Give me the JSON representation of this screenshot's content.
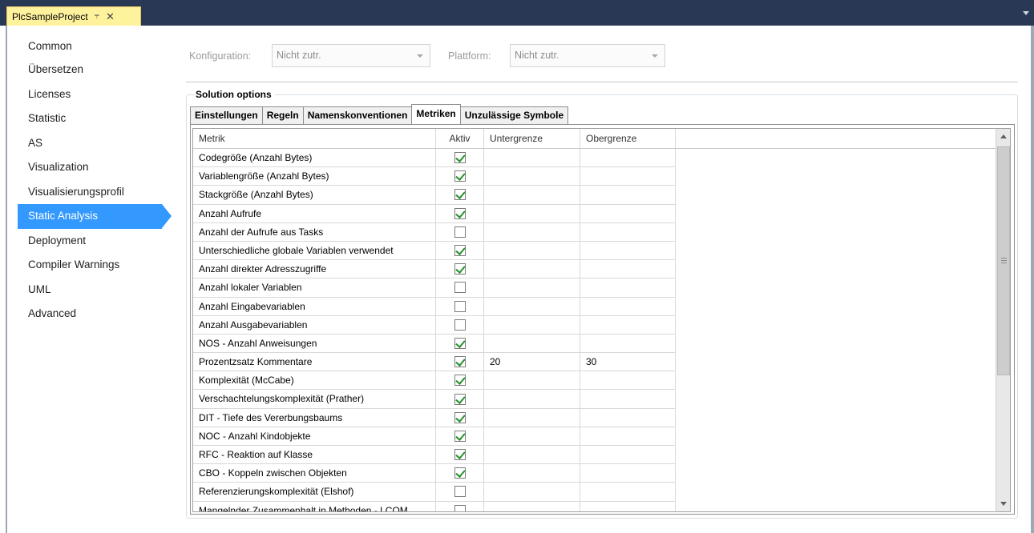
{
  "document_tab": {
    "title": "PlcSampleProject",
    "pin_icon": "pin-icon",
    "close_icon": "close-icon"
  },
  "sidebar": {
    "items": [
      {
        "label": "Common"
      },
      {
        "label": "Übersetzen"
      },
      {
        "label": "Licenses"
      },
      {
        "label": "Statistic"
      },
      {
        "label": "AS"
      },
      {
        "label": "Visualization"
      },
      {
        "label": "Visualisierungsprofil"
      },
      {
        "label": "Static Analysis",
        "selected": true
      },
      {
        "label": "Deployment"
      },
      {
        "label": "Compiler Warnings"
      },
      {
        "label": "UML"
      },
      {
        "label": "Advanced"
      }
    ]
  },
  "config": {
    "konfiguration_label": "Konfiguration:",
    "konfiguration_value": "Nicht zutr.",
    "plattform_label": "Plattform:",
    "plattform_value": "Nicht zutr."
  },
  "solution_options": {
    "title": "Solution options",
    "tabs": [
      {
        "label": "Einstellungen"
      },
      {
        "label": "Regeln"
      },
      {
        "label": "Namenskonventionen"
      },
      {
        "label": "Metriken",
        "active": true
      },
      {
        "label": "Unzulässige Symbole"
      }
    ]
  },
  "grid": {
    "columns": [
      "Metrik",
      "Aktiv",
      "Untergrenze",
      "Obergrenze"
    ],
    "rows": [
      {
        "metrik": "Codegröße (Anzahl Bytes)",
        "aktiv": true,
        "unter": "",
        "ober": ""
      },
      {
        "metrik": "Variablengröße (Anzahl Bytes)",
        "aktiv": true,
        "unter": "",
        "ober": ""
      },
      {
        "metrik": "Stackgröße (Anzahl Bytes)",
        "aktiv": true,
        "unter": "",
        "ober": ""
      },
      {
        "metrik": "Anzahl Aufrufe",
        "aktiv": true,
        "unter": "",
        "ober": ""
      },
      {
        "metrik": "Anzahl der Aufrufe aus Tasks",
        "aktiv": false,
        "unter": "",
        "ober": ""
      },
      {
        "metrik": "Unterschiedliche globale Variablen verwendet",
        "aktiv": true,
        "unter": "",
        "ober": ""
      },
      {
        "metrik": "Anzahl direkter Adresszugriffe",
        "aktiv": true,
        "unter": "",
        "ober": ""
      },
      {
        "metrik": "Anzahl lokaler Variablen",
        "aktiv": false,
        "unter": "",
        "ober": ""
      },
      {
        "metrik": "Anzahl Eingabevariablen",
        "aktiv": false,
        "unter": "",
        "ober": ""
      },
      {
        "metrik": "Anzahl Ausgabevariablen",
        "aktiv": false,
        "unter": "",
        "ober": ""
      },
      {
        "metrik": "NOS - Anzahl Anweisungen",
        "aktiv": true,
        "unter": "",
        "ober": ""
      },
      {
        "metrik": "Prozentzsatz Kommentare",
        "aktiv": true,
        "unter": "20",
        "ober": "30"
      },
      {
        "metrik": "Komplexität (McCabe)",
        "aktiv": true,
        "unter": "",
        "ober": ""
      },
      {
        "metrik": "Verschachtelungskomplexität (Prather)",
        "aktiv": true,
        "unter": "",
        "ober": ""
      },
      {
        "metrik": "DIT - Tiefe des Vererbungsbaums",
        "aktiv": true,
        "unter": "",
        "ober": ""
      },
      {
        "metrik": "NOC - Anzahl Kindobjekte",
        "aktiv": true,
        "unter": "",
        "ober": ""
      },
      {
        "metrik": "RFC - Reaktion auf Klasse",
        "aktiv": true,
        "unter": "",
        "ober": ""
      },
      {
        "metrik": "CBO - Koppeln zwischen Objekten",
        "aktiv": true,
        "unter": "",
        "ober": ""
      },
      {
        "metrik": "Referenzierungskomplexität (Elshof)",
        "aktiv": false,
        "unter": "",
        "ober": ""
      },
      {
        "metrik": "Mangelnder Zusammenhalt in Methoden - LCOM",
        "aktiv": false,
        "unter": "",
        "ober": ""
      }
    ]
  },
  "colors": {
    "tabstrip": "#293955",
    "doc_tab": "#fff29d",
    "selection": "#3399ff",
    "checkmark": "#27912b"
  }
}
